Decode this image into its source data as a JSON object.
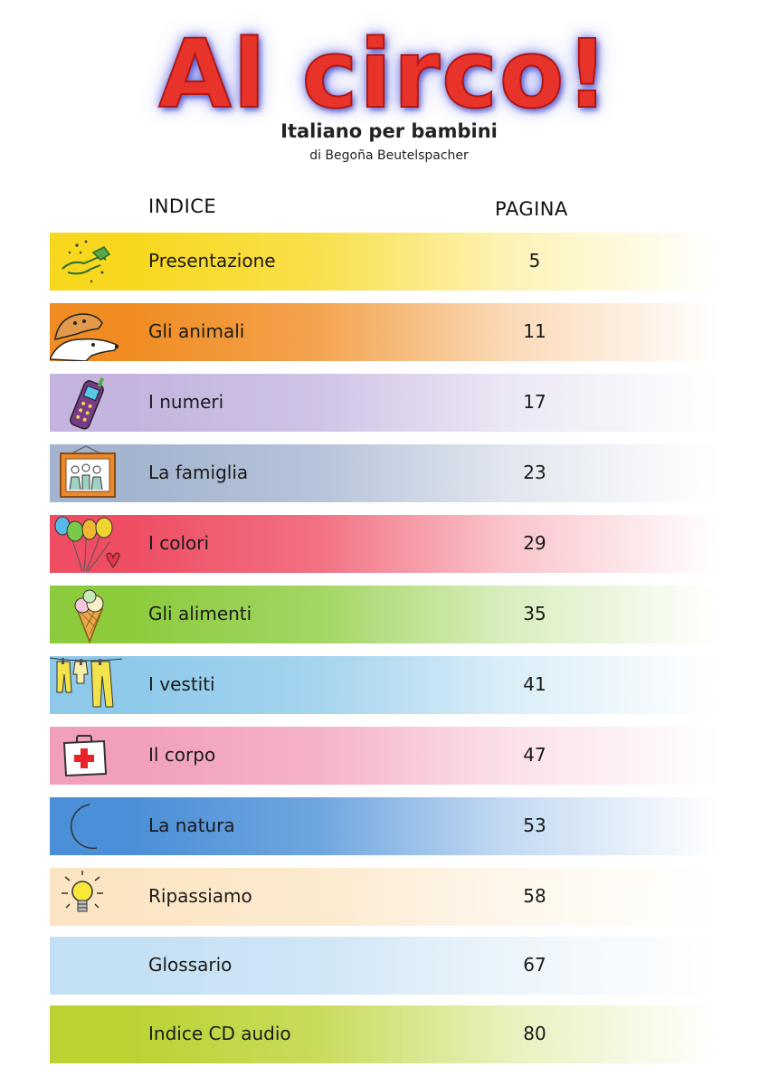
{
  "header": {
    "title": "Al circo!",
    "subtitle": "Italiano per bambini",
    "author": "di Begoña Beutelspacher"
  },
  "columns": {
    "index_label": "INDICE",
    "page_label": "PAGINA"
  },
  "entries": [
    {
      "label": "Presentazione",
      "page": "5",
      "color": "#f7d81e",
      "icon": "handshake-icon"
    },
    {
      "label": "Gli animali",
      "page": "11",
      "color": "#f08c22",
      "icon": "dogs-icon"
    },
    {
      "label": "I numeri",
      "page": "17",
      "color": "#c4b4df",
      "icon": "cellphone-icon"
    },
    {
      "label": "La famiglia",
      "page": "23",
      "color": "#a4b4cf",
      "icon": "family-portrait-icon"
    },
    {
      "label": "I colori",
      "page": "29",
      "color": "#ee4d63",
      "icon": "balloons-icon"
    },
    {
      "label": "Gli alimenti",
      "page": "35",
      "color": "#8ccb3c",
      "icon": "ice-cream-icon"
    },
    {
      "label": "I vestiti",
      "page": "41",
      "color": "#8ec9ea",
      "icon": "clothesline-icon"
    },
    {
      "label": "Il corpo",
      "page": "47",
      "color": "#f29fbb",
      "icon": "first-aid-kit-icon"
    },
    {
      "label": "La natura",
      "page": "53",
      "color": "#4a8fd7",
      "icon": "moon-icon"
    },
    {
      "label": "Ripassiamo",
      "page": "58",
      "color": "#fce5c3",
      "icon": "light-bulb-icon"
    },
    {
      "label": "Glossario",
      "page": "67",
      "color": "#c4e0f4",
      "icon": ""
    },
    {
      "label": "Indice CD audio",
      "page": "80",
      "color": "#bcd233",
      "icon": ""
    }
  ]
}
